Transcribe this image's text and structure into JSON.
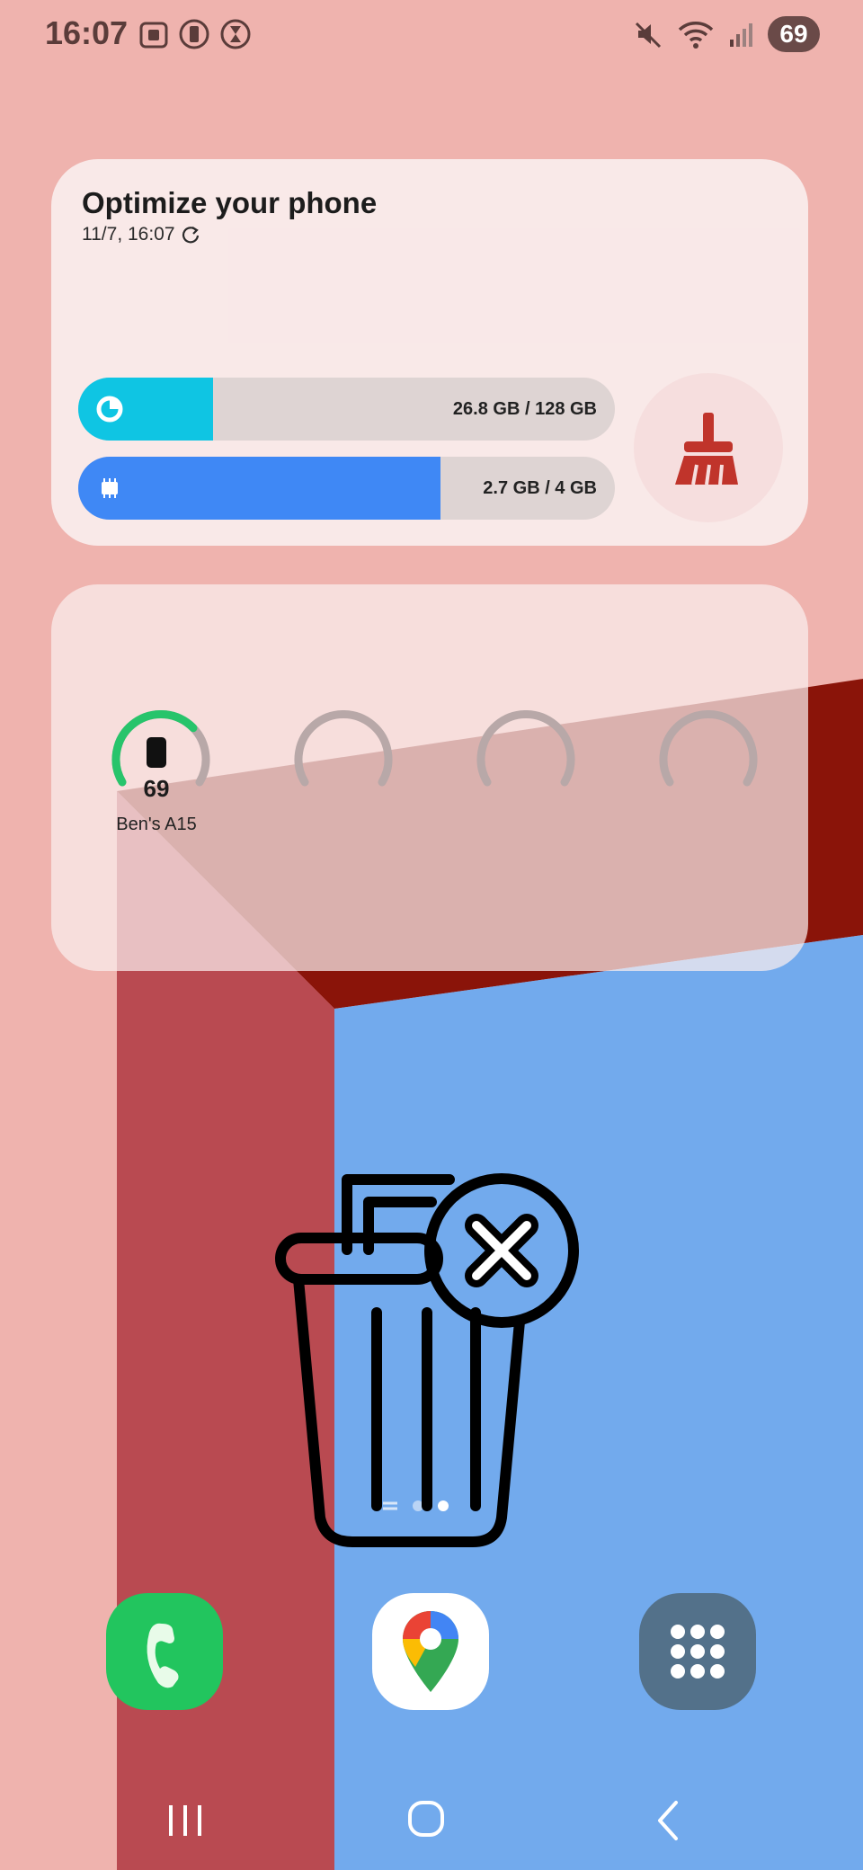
{
  "status_bar": {
    "time": "16:07",
    "left_icons": [
      "screenshot-icon",
      "phone-vibrate-icon",
      "hourglass-icon"
    ],
    "right_icons": [
      "mute-icon",
      "wifi-icon",
      "signal-icon"
    ],
    "battery": "69"
  },
  "optimize_widget": {
    "title": "Optimize your phone",
    "subtitle": "11/7, 16:07",
    "refresh_icon": "refresh-icon",
    "storage": {
      "label": "26.8 GB / 128 GB",
      "used": 26.8,
      "total": 128,
      "color": "#0fc5e3",
      "icon": "storage-pie-icon"
    },
    "memory": {
      "label": "2.7 GB / 4 GB",
      "used": 2.7,
      "total": 4,
      "color": "#3f88f5",
      "icon": "memory-chip-icon"
    },
    "clean_button_icon": "broom-icon",
    "clean_color": "#c0342b"
  },
  "battery_widget": {
    "devices": [
      {
        "name": "Ben's A15",
        "percent": "69",
        "level": 0.69,
        "icon": "phone-icon"
      },
      {
        "name": "",
        "percent": "",
        "level": 0
      },
      {
        "name": "",
        "percent": "",
        "level": 0
      },
      {
        "name": "",
        "percent": "",
        "level": 0
      }
    ],
    "ring_color": "#27c46b"
  },
  "overlay": {
    "icon": "trash-delete-icon"
  },
  "dock": [
    {
      "icon": "phone-icon",
      "color": "#22c55e"
    },
    {
      "icon": "google-maps-icon",
      "color": "#ffffff"
    },
    {
      "icon": "apps-grid-icon",
      "color": "#53718a"
    }
  ],
  "nav_bar": [
    "recents-button",
    "home-button",
    "back-button"
  ]
}
